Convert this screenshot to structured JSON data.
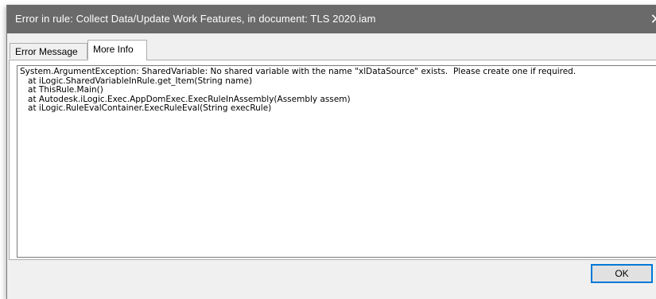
{
  "window": {
    "title": "Error in rule: Collect Data/Update Work Features, in document: TLS 2020.iam",
    "close_glyph": "✕"
  },
  "tabs": [
    {
      "label": "Error Message",
      "active": false
    },
    {
      "label": "More Info",
      "active": true
    }
  ],
  "details": {
    "lines": [
      "System.ArgumentException: SharedVariable: No shared variable with the name \"xlDataSource\" exists.  Please create one if required.",
      "   at iLogic.SharedVariableInRule.get_Item(String name)",
      "   at ThisRule.Main()",
      "   at Autodesk.iLogic.Exec.AppDomExec.ExecRuleInAssembly(Assembly assem)",
      "   at iLogic.RuleEvalContainer.ExecRuleEval(String execRule)"
    ]
  },
  "buttons": {
    "ok_label": "OK"
  },
  "colors": {
    "titlebar": "#6a6a6a",
    "accent": "#0078d7"
  }
}
